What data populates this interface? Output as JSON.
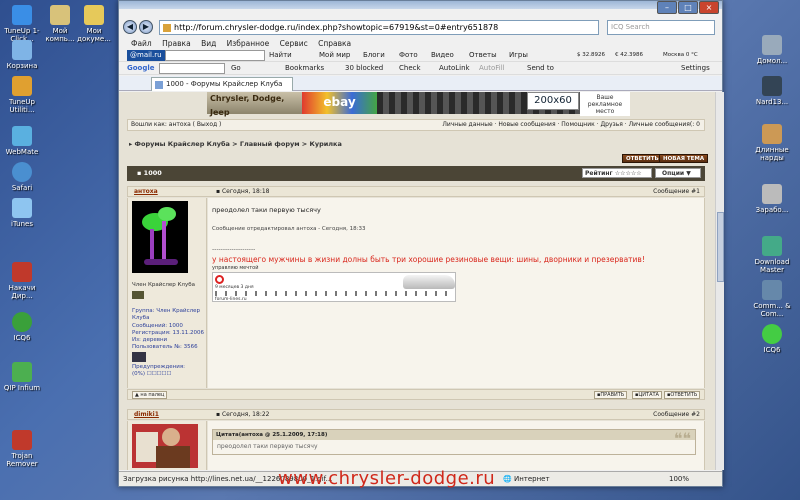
{
  "desktop": {
    "left_icons": [
      {
        "label": "TuneUp 1-Click...",
        "color": "#3a8ee6"
      },
      {
        "label": "Мой компь...",
        "color": "#d8c27a"
      },
      {
        "label": "Мои докуме...",
        "color": "#e6c95a"
      },
      {
        "label": "Корзина",
        "color": "#7fb4e6"
      },
      {
        "label": "TuneUp Utiliti...",
        "color": "#e0a030"
      },
      {
        "label": "WebMate",
        "color": "#5ab0e0"
      },
      {
        "label": "Safari",
        "color": "#4a8fd0"
      },
      {
        "label": "iTunes",
        "color": "#8ec5f0"
      },
      {
        "label": "Накачи Дир...",
        "color": "#c0392b"
      },
      {
        "label": "ICQ6",
        "color": "#3aa03a"
      },
      {
        "label": "QIP Infium",
        "color": "#4caf50"
      },
      {
        "label": "Trojan Remover",
        "color": "#c0392b"
      }
    ],
    "right_icons": [
      {
        "label": "Домол...",
        "color": "#9ab"
      },
      {
        "label": "Nard13...",
        "color": "#345"
      },
      {
        "label": "Длинные нарды",
        "color": "#c95"
      },
      {
        "label": "Зарабо...",
        "color": "#bbb"
      },
      {
        "label": "Download Master",
        "color": "#4a8"
      },
      {
        "label": "Comm... & Com...",
        "color": "#68a"
      },
      {
        "label": "ICQ6",
        "color": "#4c4"
      }
    ]
  },
  "browser": {
    "url": "http://forum.chrysler-dodge.ru/index.php?showtopic=67919&st=0#entry651878",
    "search_placeholder": "ICQ Search",
    "menu": [
      "Файл",
      "Правка",
      "Вид",
      "Избранное",
      "Сервис",
      "Справка"
    ],
    "toolbar1": {
      "mailru": "@mail.ru",
      "search_field": "",
      "poisk": "Найти",
      "items": [
        "Мой мир",
        "Блоги",
        "Фото",
        "Видео",
        "Ответы",
        "Игры"
      ],
      "usd": "$ 32.8926",
      "eur": "€ 42.3986",
      "weather": "Москва 0 °C"
    },
    "toolbar2": {
      "google": "Google",
      "go": "Go",
      "bookmarks": "Bookmarks",
      "blocked": "30 blocked",
      "check": "Check",
      "autolink": "AutoLink",
      "autofill": "AutoFill",
      "sendto": "Send to",
      "settings": "Settings"
    },
    "tab_title": "1000 - Форумы Крайслер Клуба",
    "status_text": "Загрузка рисунка http://lines.net.ua/__1226089800_1.gif...",
    "zone_text": "Интернет",
    "zoom_text": "100%"
  },
  "page": {
    "banner_left": "Chrysler, Dodge, Jeep",
    "banner_ebay": "ebay",
    "ad_size": "200x60",
    "ad_text": "Ваше рекламное место",
    "userbar_left": "Вошли как: антоха ( Выход )",
    "userbar_right": "Личные данные · Новые сообщения · Помощник · Друзья · Личные сообщения(: 0",
    "breadcrumb": "Форумы Крайслер Клуба > Главный форум > Курилка",
    "reply_btn": "ОТВЕТИТЬ",
    "newtopic_btn": "НОВАЯ ТЕМА",
    "topic_title": "1000",
    "rating_label": "Рейтинг ☆☆☆☆☆",
    "options_label": "Опции ▼",
    "post1": {
      "author": "антоха",
      "date": "Сегодня, 18:18",
      "num": "Сообщение #1",
      "role": "Член Крайслер Клуба",
      "group": "Группа: Член Крайслер Клуба",
      "messages": "Сообщений: 1000",
      "registered": "Регистрация: 13.11.2006",
      "from": "Из: деревни",
      "user_no": "Пользователь №: 3566",
      "warnings": "Предупреждения:",
      "warn_value": "(0%) ☐☐☐☐☐",
      "text": "преодолел таки первую тысячу",
      "edited": "Сообщение отредактировал антоха - Сегодня, 18:33",
      "dashes": "--------------------",
      "signature": "у настоящего мужчины в жизни долны быть три хорошие резиновые вещи: шины, дворники и презерватив!",
      "sig_small": "управляю мечтой",
      "widget_months": "9 месяцев 3 дня",
      "widget_site": "forum-lines.ru",
      "footer_top": "▲ на палец",
      "footer_btn1": "▪ПРАВИТЬ",
      "footer_btn2": "▪ЦИТАТА",
      "footer_btn3": "▪ОТВЕТИТЬ"
    },
    "post2": {
      "author": "dimiki1",
      "date": "Сегодня, 18:22",
      "num": "Сообщение #2",
      "quote_header": "Цитата(антоха @ 25.1.2009, 17:18)",
      "quote_text": "преодолел таки первую тысячу"
    },
    "watermark": "www.chrysler-dodge.ru"
  }
}
